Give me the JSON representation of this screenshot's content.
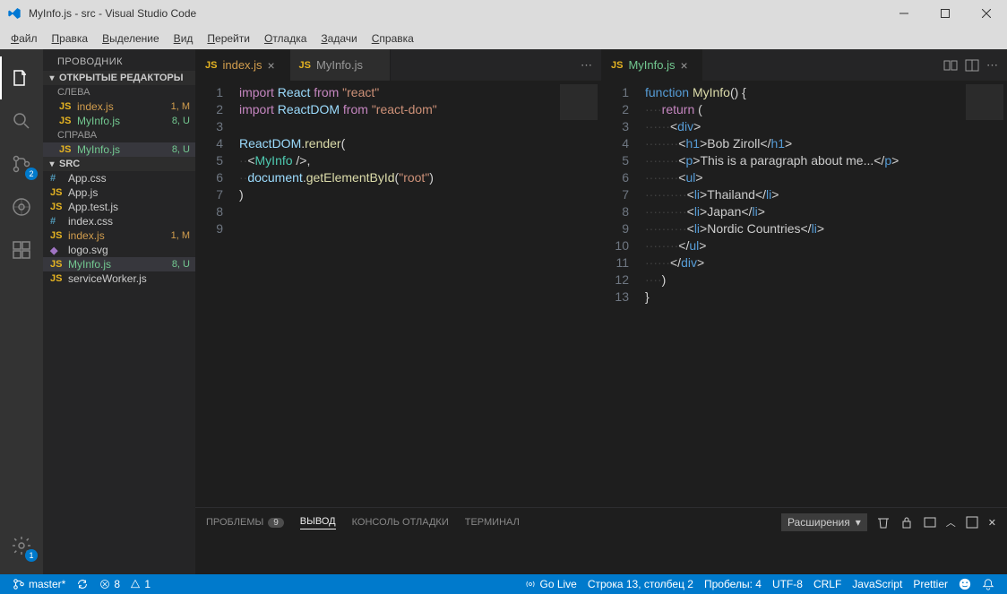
{
  "title": "MyInfo.js - src - Visual Studio Code",
  "menu": [
    "Файл",
    "Правка",
    "Выделение",
    "Вид",
    "Перейти",
    "Отладка",
    "Задачи",
    "Справка"
  ],
  "activity_badges": {
    "scm": "2",
    "settings": "1"
  },
  "sidebar": {
    "title": "ПРОВОДНИК",
    "open_editors": "ОТКРЫТЫЕ РЕДАКТОРЫ",
    "left": "СЛЕВА",
    "right": "СПРАВА",
    "folder": "SRC",
    "editors_left": [
      {
        "name": "index.js",
        "status": "1, M",
        "cls": "modified",
        "icontype": "js"
      },
      {
        "name": "MyInfo.js",
        "status": "8, U",
        "cls": "untracked",
        "icontype": "js"
      }
    ],
    "editors_right": [
      {
        "name": "MyInfo.js",
        "status": "8, U",
        "cls": "untracked",
        "icontype": "js",
        "selected": true
      }
    ],
    "files": [
      {
        "name": "App.css",
        "status": "",
        "cls": "",
        "icontype": "css"
      },
      {
        "name": "App.js",
        "status": "",
        "cls": "",
        "icontype": "js"
      },
      {
        "name": "App.test.js",
        "status": "",
        "cls": "",
        "icontype": "js"
      },
      {
        "name": "index.css",
        "status": "",
        "cls": "",
        "icontype": "css"
      },
      {
        "name": "index.js",
        "status": "1, M",
        "cls": "modified",
        "icontype": "js"
      },
      {
        "name": "logo.svg",
        "status": "",
        "cls": "",
        "icontype": "img"
      },
      {
        "name": "MyInfo.js",
        "status": "8, U",
        "cls": "untracked",
        "icontype": "js",
        "selected": true
      },
      {
        "name": "serviceWorker.js",
        "status": "",
        "cls": "",
        "icontype": "js"
      }
    ]
  },
  "left_group": {
    "tabs": [
      {
        "name": "index.js",
        "active": true,
        "cls": "modified"
      },
      {
        "name": "MyInfo.js",
        "active": false,
        "cls": ""
      }
    ],
    "lines": [
      {
        "n": 1,
        "html": "<span class='kw'>import</span> <span class='id'>React</span> <span class='kw'>from</span> <span class='str'>\"react\"</span>"
      },
      {
        "n": 2,
        "html": "<span class='kw'>import</span> <span class='id'>ReactDOM</span> <span class='kw'>from</span> <span class='str'>\"react-dom\"</span>"
      },
      {
        "n": 3,
        "html": ""
      },
      {
        "n": 4,
        "html": "<span class='id'>ReactDOM</span><span class='br'>.</span><span class='fn'>render</span><span class='br'>(</span>"
      },
      {
        "n": 5,
        "html": "<span class='ws'>··</span><span class='br'>&lt;</span><span class='comp'>MyInfo</span> <span class='br'>/&gt;,</span>"
      },
      {
        "n": 6,
        "html": "<span class='ws'>··</span><span class='id'>document</span><span class='br'>.</span><span class='fn'>getElementById</span><span class='br'>(</span><span class='str'>\"root\"</span><span class='br'>)</span>"
      },
      {
        "n": 7,
        "html": "<span class='br'>)</span>"
      },
      {
        "n": 8,
        "html": ""
      },
      {
        "n": 9,
        "html": ""
      }
    ]
  },
  "right_group": {
    "tabs": [
      {
        "name": "MyInfo.js",
        "active": true,
        "cls": "untracked"
      }
    ],
    "lines": [
      {
        "n": 1,
        "html": "<span class='tag'>function</span> <span class='fn'>MyInfo</span><span class='br'>() {</span>"
      },
      {
        "n": 2,
        "html": "<span class='ws'>····</span><span class='kw'>return</span> <span class='br'>(</span>"
      },
      {
        "n": 3,
        "html": "<span class='ws'>······</span><span class='br'>&lt;</span><span class='tag'>div</span><span class='br'>&gt;</span>"
      },
      {
        "n": 4,
        "html": "<span class='ws'>········</span><span class='br'>&lt;</span><span class='tag'>h1</span><span class='br'>&gt;</span>Bob Ziroll<span class='br'>&lt;/</span><span class='tag'>h1</span><span class='br'>&gt;</span>"
      },
      {
        "n": 5,
        "html": "<span class='ws'>········</span><span class='br'>&lt;</span><span class='tag'>p</span><span class='br'>&gt;</span>This is a paragraph about me...<span class='br'>&lt;/</span><span class='tag'>p</span><span class='br'>&gt;</span>"
      },
      {
        "n": 6,
        "html": "<span class='ws'>········</span><span class='br'>&lt;</span><span class='tag'>ul</span><span class='br'>&gt;</span>"
      },
      {
        "n": 7,
        "html": "<span class='ws'>··········</span><span class='br'>&lt;</span><span class='tag'>li</span><span class='br'>&gt;</span>Thailand<span class='br'>&lt;/</span><span class='tag'>li</span><span class='br'>&gt;</span>"
      },
      {
        "n": 8,
        "html": "<span class='ws'>··········</span><span class='br'>&lt;</span><span class='tag'>li</span><span class='br'>&gt;</span>Japan<span class='br'>&lt;/</span><span class='tag'>li</span><span class='br'>&gt;</span>"
      },
      {
        "n": 9,
        "html": "<span class='ws'>··········</span><span class='br'>&lt;</span><span class='tag'>li</span><span class='br'>&gt;</span>Nordic Countries<span class='br'>&lt;/</span><span class='tag'>li</span><span class='br'>&gt;</span>"
      },
      {
        "n": 10,
        "html": "<span class='ws'>········</span><span class='br'>&lt;/</span><span class='tag'>ul</span><span class='br'>&gt;</span>"
      },
      {
        "n": 11,
        "html": "<span class='ws'>······</span><span class='br'>&lt;/</span><span class='tag'>div</span><span class='br'>&gt;</span>"
      },
      {
        "n": 12,
        "html": "<span class='ws'>····</span><span class='br'>)</span>"
      },
      {
        "n": 13,
        "html": "<span class='br'>}</span>"
      }
    ]
  },
  "panel": {
    "tabs": {
      "problems": "ПРОБЛЕМЫ",
      "problems_count": "9",
      "output": "ВЫВОД",
      "debug": "КОНСОЛЬ ОТЛАДКИ",
      "terminal": "ТЕРМИНАЛ"
    },
    "dropdown": "Расширения"
  },
  "status": {
    "branch": "master*",
    "errwarn_err": "8",
    "errwarn_warn": "1",
    "golive": "Go Live",
    "cursor": "Строка 13, столбец 2",
    "spaces": "Пробелы: 4",
    "encoding": "UTF-8",
    "eol": "CRLF",
    "lang": "JavaScript",
    "prettier": "Prettier"
  }
}
